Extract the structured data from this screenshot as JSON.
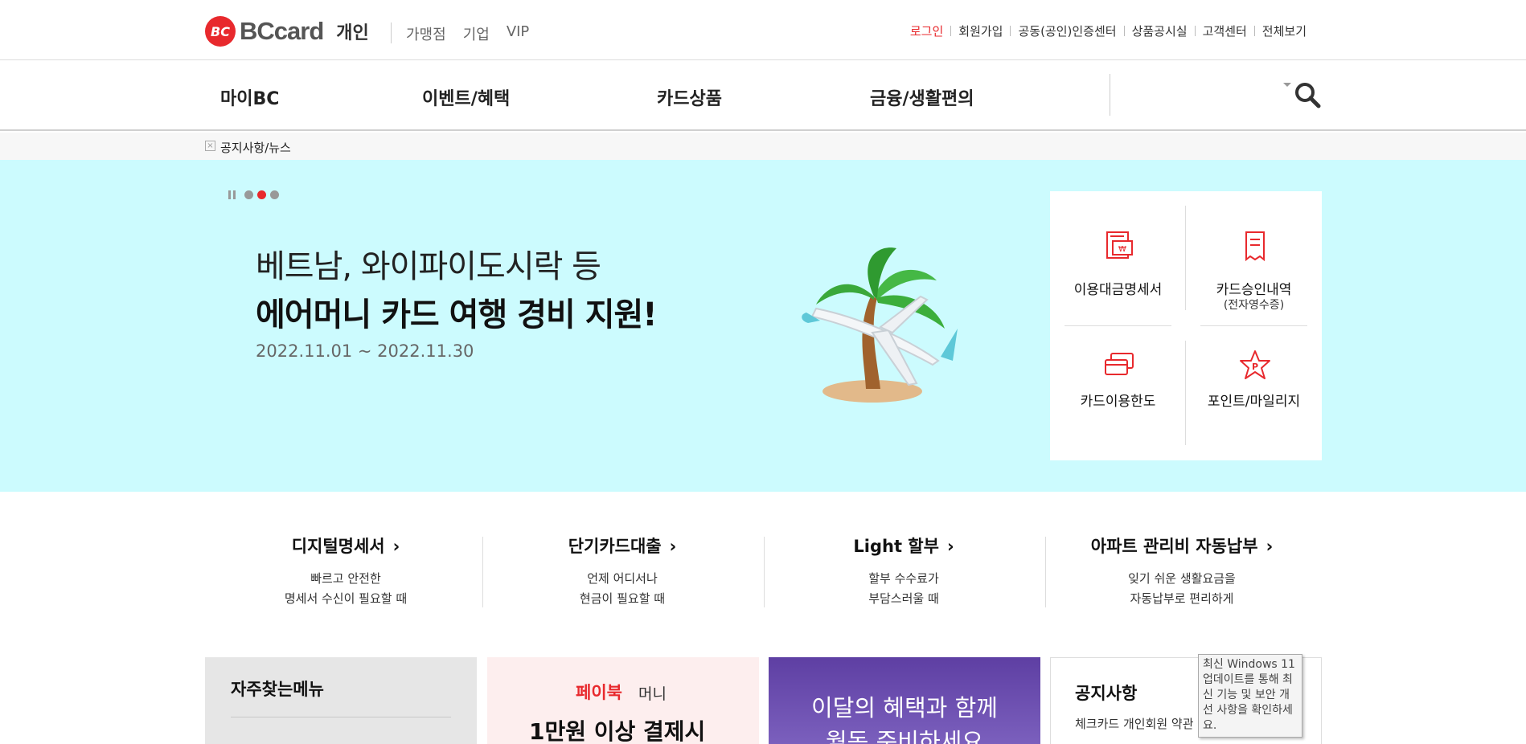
{
  "header": {
    "logo_mark": "BC",
    "logo_text": "BCcard",
    "logo_sub": "개인",
    "segments": [
      "가맹점",
      "기업",
      "VIP"
    ],
    "util_links": [
      "로그인",
      "회원가입",
      "공동(공인)인증센터",
      "상품공시실",
      "고객센터",
      "전체보기"
    ]
  },
  "gnb": {
    "items": [
      "마이BC",
      "이벤트/혜택",
      "카드상품",
      "금융/생활편의"
    ]
  },
  "breadcrumb": {
    "current": "공지사항/뉴스"
  },
  "hero": {
    "line1": "베트남, 와이파이도시락 등",
    "line2": "에어머니 카드 여행 경비 지원!",
    "date": "2022.11.01 ~ 2022.11.30",
    "pager": {
      "count": 3,
      "active_index": 1
    }
  },
  "quick_menu": [
    {
      "label": "이용대금명세서",
      "sub": "",
      "icon": "statement-icon"
    },
    {
      "label": "카드승인내역",
      "sub": "(전자영수증)",
      "icon": "receipt-icon"
    },
    {
      "label": "카드이용한도",
      "sub": "",
      "icon": "card-limit-icon"
    },
    {
      "label": "포인트/마일리지",
      "sub": "",
      "icon": "point-star-icon"
    }
  ],
  "shortcuts": [
    {
      "title": "디지털명세서",
      "desc1": "빠르고 안전한",
      "desc2": "명세서 수신이 필요할 때"
    },
    {
      "title": "단기카드대출",
      "desc1": "언제 어디서나",
      "desc2": "현금이 필요할 때"
    },
    {
      "title": "Light 할부",
      "desc1": "할부 수수료가",
      "desc2": "부담스러울 때"
    },
    {
      "title": "아파트 관리비 자동납부",
      "desc1": "잊기 쉬운 생활요금을",
      "desc2": "자동납부로 편리하게"
    }
  ],
  "cards": {
    "favorites_title": "자주찾는메뉴",
    "paybook_brand": "페이북",
    "paybook_brand2": "머니",
    "paybook_text": "1만원 이상 결제시",
    "promo_line1": "이달의 혜택과 함께",
    "promo_line2": "월동 준비하세요",
    "notice_title": "공지사항",
    "notice_item": "체크카드 개인회원 약관"
  },
  "tooltip": {
    "text": "최신 Windows 11 업데이트를 통해 최신 기능 및 보안 개선 사항을 확인하세요."
  },
  "colors": {
    "brand_red": "#e8292d",
    "hero_bg": "#ccfbfe",
    "promo_purple": "#5e3fa3"
  }
}
